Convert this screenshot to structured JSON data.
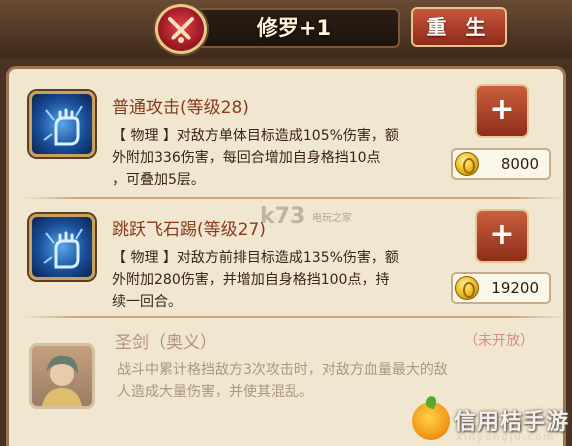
{
  "header": {
    "title": "修罗+1",
    "reset_label": "重 生",
    "emblem_icon": "crossed-swords-icon"
  },
  "skills": [
    {
      "name": "普通攻击(等级28)",
      "icon": "fist-icon",
      "desc_lines": [
        "【 物理 】对敌方单体目标造成105%伤害，额",
        "外附加336伤害，每回合增加自身格挡10点",
        "，可叠加5层。"
      ],
      "plus_label": "+",
      "cost": "8000"
    },
    {
      "name": "跳跃飞石踢(等级27)",
      "icon": "fist-icon",
      "desc_lines": [
        "【 物理 】对敌方前排目标造成135%伤害，额",
        "外附加280伤害，并增加自身格挡100点，持",
        "续一回合。"
      ],
      "plus_label": "+",
      "cost": "19200"
    }
  ],
  "locked_skill": {
    "name": "圣剑（奥义）",
    "status": "（未开放）",
    "icon": "saint-portrait-icon",
    "desc_lines": [
      "战斗中累计格挡敌方3次攻击时，对敌方血量最大的敌",
      "人造成大量伤害，并使其混乱。"
    ]
  },
  "watermarks": {
    "center": "k73",
    "center_small": "电玩之家",
    "brand": "信用桔手游",
    "brand_url": "xinyongju.com"
  },
  "colors": {
    "accent_red": "#a71d27",
    "skill_name": "#8a3a1c",
    "panel_bg": "#f1e6d0",
    "button": "#b04a30"
  }
}
